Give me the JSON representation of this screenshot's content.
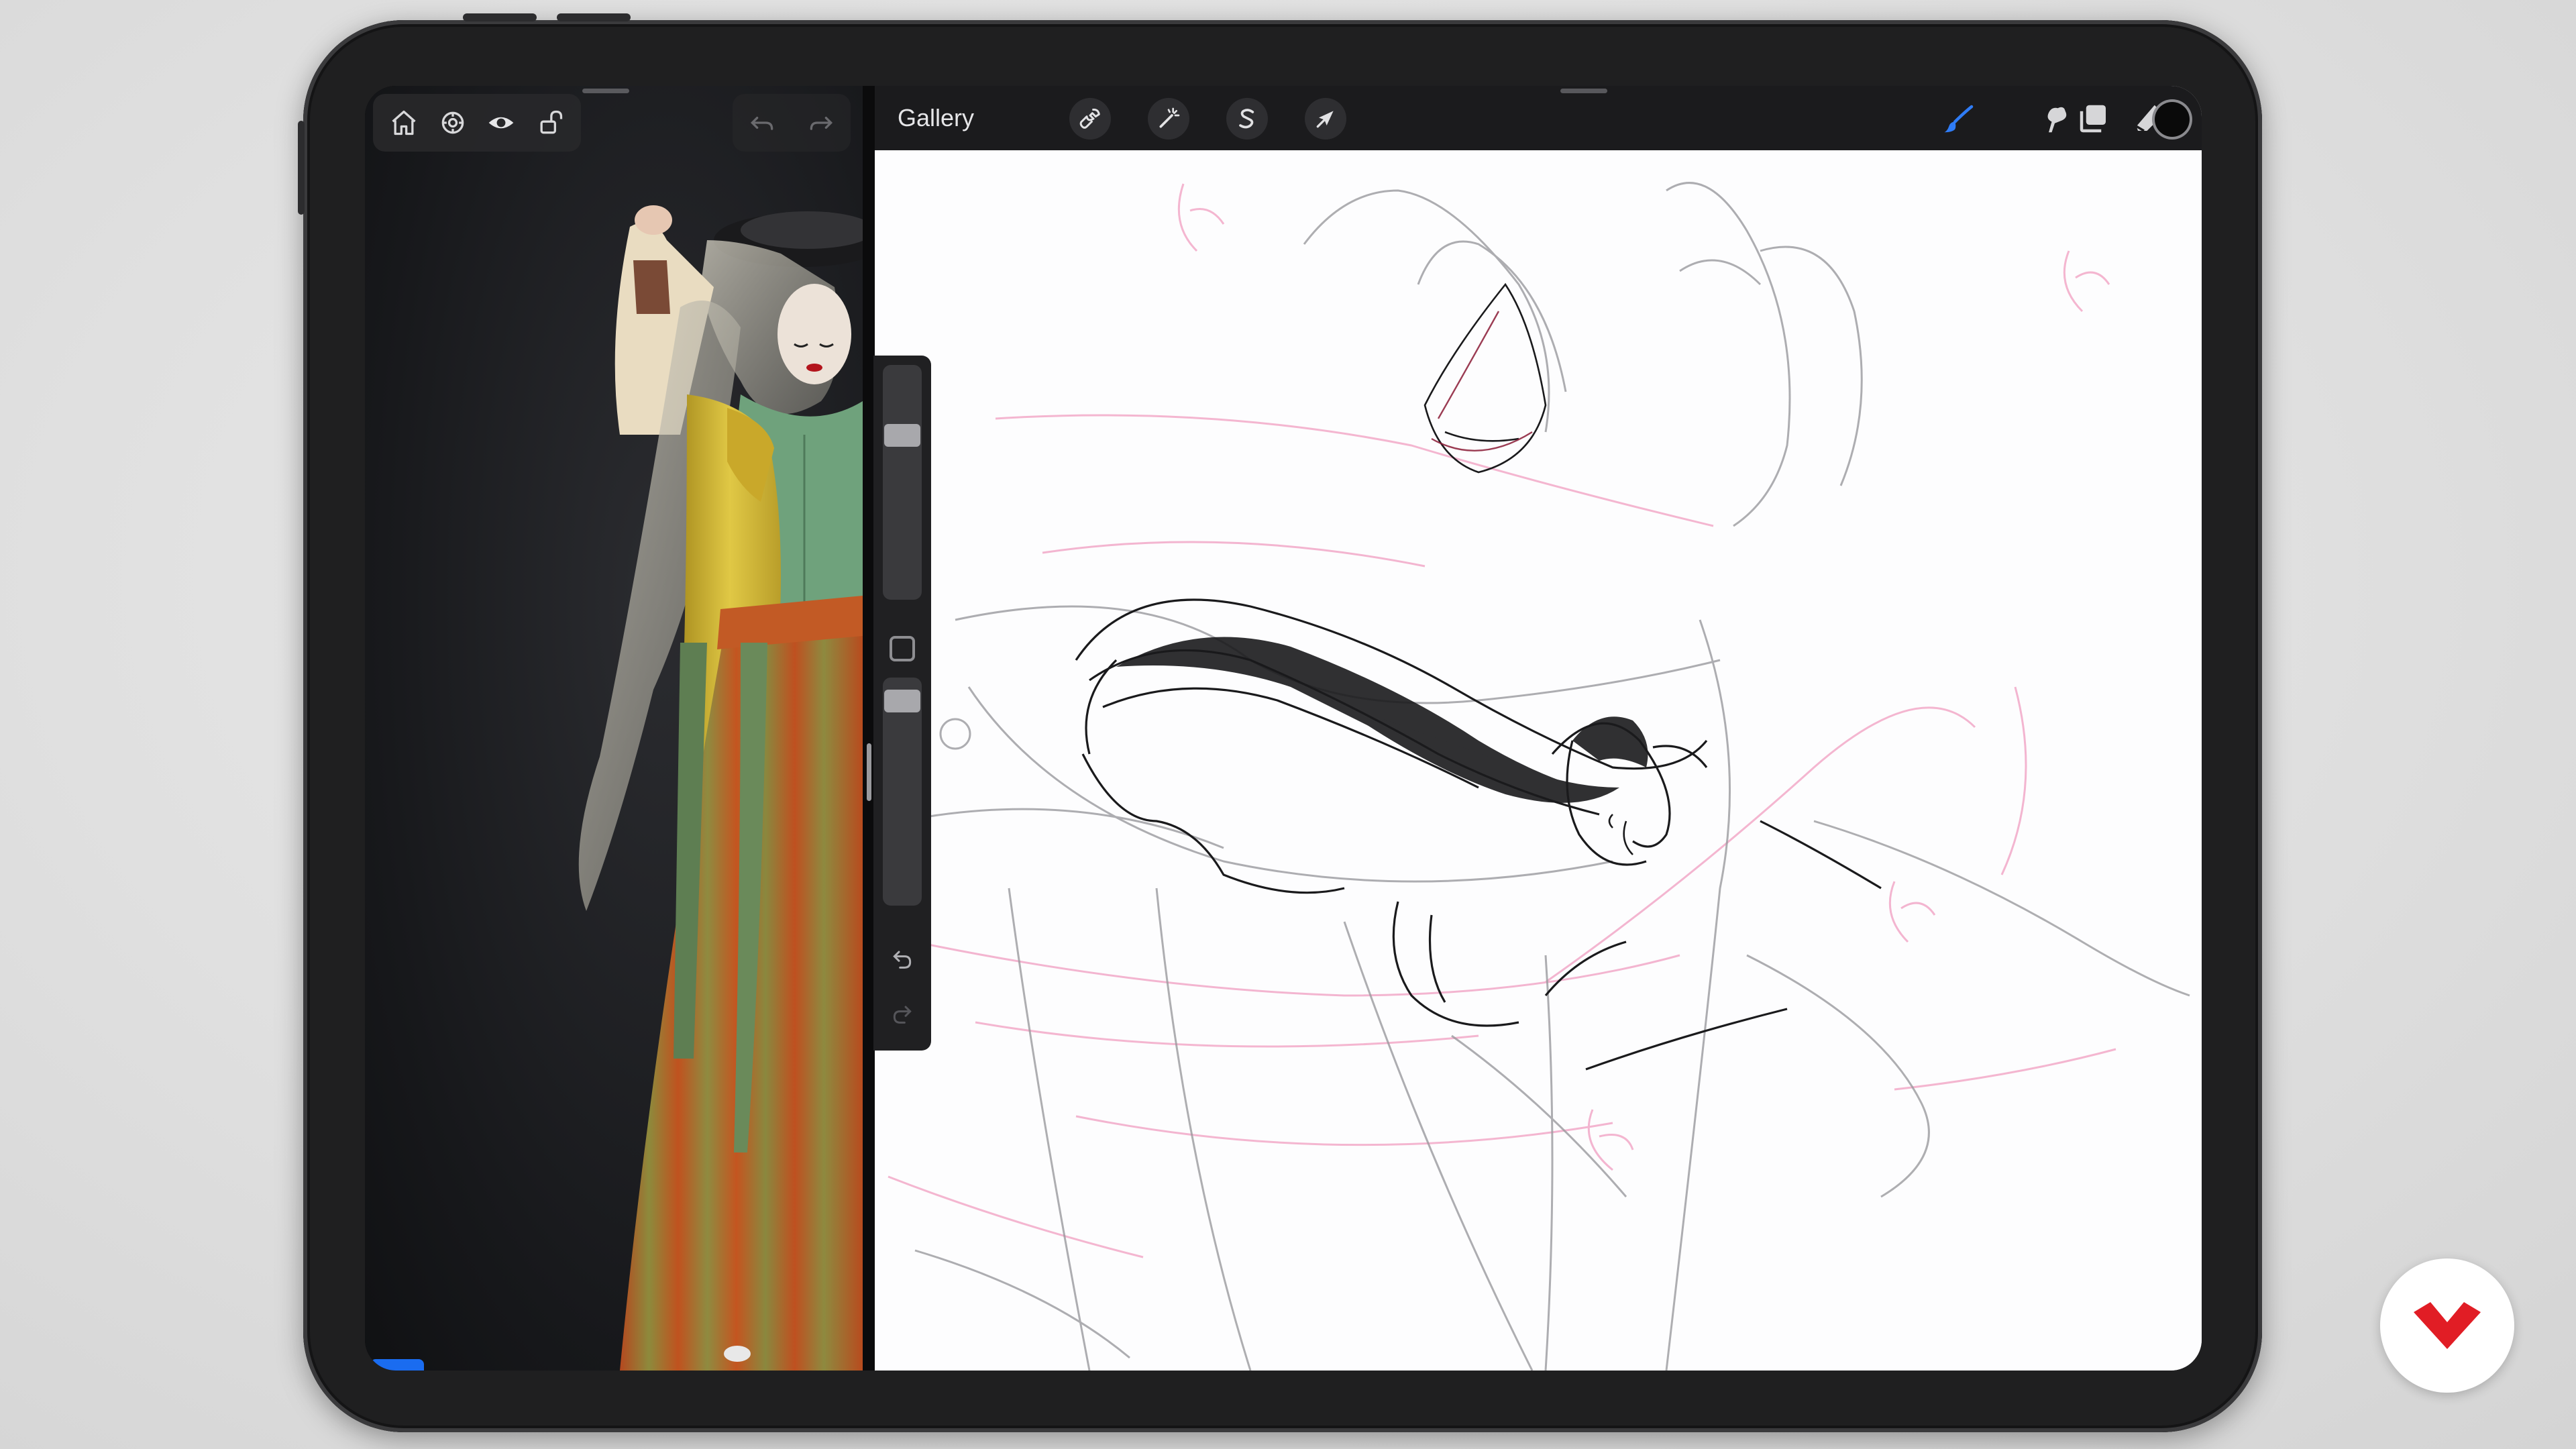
{
  "topbar": {
    "gallery_label": "Gallery",
    "actions_icon": "wrench-icon",
    "adjustments_icon": "magic-wand-icon",
    "selection_icon": "selection-s-icon",
    "transform_icon": "arrow-cursor-icon",
    "brush_icon": "brush-icon",
    "smudge_icon": "smudge-icon",
    "eraser_icon": "eraser-icon",
    "layers_icon": "layers-icon",
    "current_color": "#0a0a0a",
    "brush_active_color": "#2f7cf6"
  },
  "reference_pane": {
    "toolbar_icons": [
      "home-icon",
      "settings-icon",
      "eye-icon",
      "unlock-icon"
    ],
    "undo_icons": [
      "undo-icon",
      "redo-icon"
    ]
  },
  "sidebar": {
    "brush_size": 0.28,
    "brush_opacity": 0.06,
    "undo_icon": "undo-icon",
    "redo_icon": "redo-icon"
  },
  "branding": {
    "logo_color": "#e11d25"
  }
}
